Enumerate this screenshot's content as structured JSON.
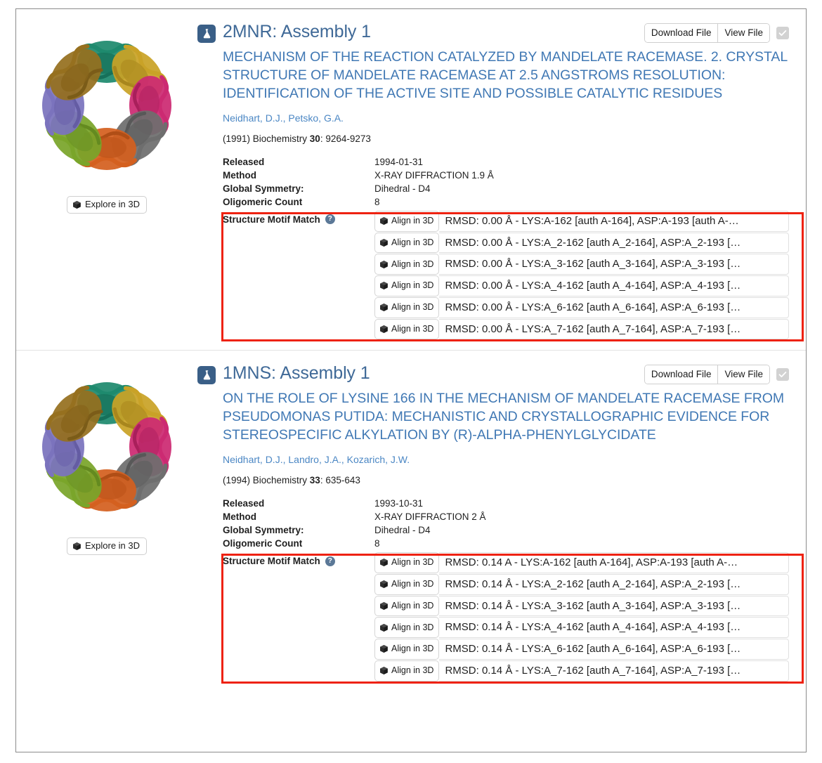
{
  "entries": [
    {
      "id_title": "2MNR: Assembly 1",
      "flask_icon": "flask-icon",
      "structure_title": "MECHANISM OF THE REACTION CATALYZED BY MANDELATE RACEMASE. 2. CRYSTAL STRUCTURE OF MANDELATE RACEMASE AT 2.5 ANGSTROMS RESOLUTION: IDENTIFICATION OF THE ACTIVE SITE AND POSSIBLE CATALYTIC RESIDUES",
      "authors": "Neidhart, D.J., Petsko, G.A.",
      "citation_prefix": "(1991) Biochemistry ",
      "citation_volume": "30",
      "citation_suffix": ": 9264-9273",
      "explore_label": "Explore in 3D",
      "download_label": "Download File",
      "view_label": "View File",
      "meta": [
        {
          "key": "Released",
          "value": "1994-01-31"
        },
        {
          "key": "Method",
          "value": "X-RAY DIFFRACTION 1.9 Å"
        },
        {
          "key": "Global Symmetry:",
          "value": "Dihedral - D4"
        },
        {
          "key": "Oligomeric Count",
          "value": "8"
        }
      ],
      "motif_label": "Structure Motif Match",
      "motif_help": "?",
      "align_label": "Align in 3D",
      "matches": [
        "RMSD: 0.00 Å - LYS:A-162 [auth A-164], ASP:A-193 [auth A-…",
        "RMSD: 0.00 Å - LYS:A_2-162 [auth A_2-164], ASP:A_2-193 […",
        "RMSD: 0.00 Å - LYS:A_3-162 [auth A_3-164], ASP:A_3-193 […",
        "RMSD: 0.00 Å - LYS:A_4-162 [auth A_4-164], ASP:A_4-193 […",
        "RMSD: 0.00 Å - LYS:A_6-162 [auth A_6-164], ASP:A_6-193 […",
        "RMSD: 0.00 Å - LYS:A_7-162 [auth A_7-164], ASP:A_7-193 […"
      ]
    },
    {
      "id_title": "1MNS: Assembly 1",
      "flask_icon": "flask-icon",
      "structure_title": "ON THE ROLE OF LYSINE 166 IN THE MECHANISM OF MANDELATE RACEMASE FROM PSEUDOMONAS PUTIDA: MECHANISTIC AND CRYSTALLOGRAPHIC EVIDENCE FOR STEREOSPECIFIC ALKYLATION BY (R)-ALPHA-PHENYLGLYCIDATE",
      "authors": "Neidhart, D.J., Landro, J.A., Kozarich, J.W.",
      "citation_prefix": "(1994) Biochemistry ",
      "citation_volume": "33",
      "citation_suffix": ": 635-643",
      "explore_label": "Explore in 3D",
      "download_label": "Download File",
      "view_label": "View File",
      "meta": [
        {
          "key": "Released",
          "value": "1993-10-31"
        },
        {
          "key": "Method",
          "value": "X-RAY DIFFRACTION 2 Å"
        },
        {
          "key": "Global Symmetry:",
          "value": "Dihedral - D4"
        },
        {
          "key": "Oligomeric Count",
          "value": "8"
        }
      ],
      "motif_label": "Structure Motif Match",
      "motif_help": "?",
      "align_label": "Align in 3D",
      "matches": [
        "RMSD: 0.14 A - LYS:A-162 [auth A-164], ASP:A-193 [auth A-…",
        "RMSD: 0.14 Å - LYS:A_2-162 [auth A_2-164], ASP:A_2-193 […",
        "RMSD: 0.14 Å - LYS:A_3-162 [auth A_3-164], ASP:A_3-193 […",
        "RMSD: 0.14 Å - LYS:A_4-162 [auth A_4-164], ASP:A_4-193 […",
        "RMSD: 0.14 Å - LYS:A_6-162 [auth A_6-164], ASP:A_6-193 […",
        "RMSD: 0.14 Å - LYS:A_7-162 [auth A_7-164], ASP:A_7-193 […"
      ]
    }
  ],
  "colors": {
    "title_link": "#3f6997",
    "structure_title_link": "#4078b4",
    "author_link": "#4b87c4",
    "highlight_border": "#ee2211",
    "flask_badge": "#3a5f87",
    "help_badge": "#5b7897",
    "checkbox_bg": "#d2d2d2"
  },
  "thumbnail_chains": [
    "#1e8a6e",
    "#c9a227",
    "#cc2a72",
    "#6e6e6e",
    "#d4601f",
    "#7aa52a",
    "#7b73bd",
    "#96701f"
  ]
}
